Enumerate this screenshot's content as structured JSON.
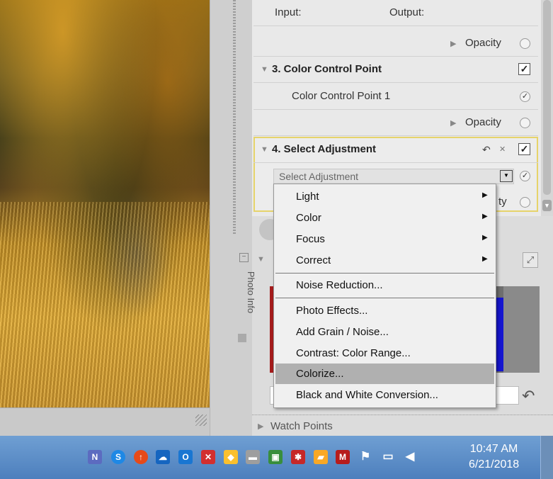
{
  "panel": {
    "input_label": "Input:",
    "output_label": "Output:",
    "opacity_label_1": "Opacity",
    "section3_title": "3. Color Control Point",
    "ccp1_label": "Color Control Point 1",
    "opacity_label_2": "Opacity",
    "section4_title": "4. Select Adjustment",
    "select_placeholder": "Select Adjustment",
    "opacity_partial": "ty",
    "check_mark": "✓",
    "undo_glyph": "↶",
    "close_glyph": "✕"
  },
  "menu": {
    "items": [
      {
        "label": "Light",
        "submenu": true
      },
      {
        "label": "Color",
        "submenu": true
      },
      {
        "label": "Focus",
        "submenu": true
      },
      {
        "label": "Correct",
        "submenu": true
      },
      {
        "label": "Noise Reduction..."
      },
      {
        "label": "Photo Effects..."
      },
      {
        "label": "Add Grain / Noise..."
      },
      {
        "label": "Contrast: Color Range..."
      },
      {
        "label": "Colorize...",
        "highlighted": true
      },
      {
        "label": "Black and White Conversion..."
      }
    ]
  },
  "lower": {
    "photo_info_label": "Photo Info",
    "watch_points_label": "Watch Points"
  },
  "taskbar": {
    "time": "10:47 AM",
    "date": "6/21/2018",
    "icons": [
      "nx-icon",
      "chat-icon",
      "upload-icon",
      "cloud-icon",
      "outlook-icon",
      "x-tool-icon",
      "shield-icon",
      "drive-icon",
      "display-icon",
      "network-icon",
      "folder-icon",
      "mcafee-icon",
      "flag-icon",
      "device-icon",
      "volume-icon"
    ]
  },
  "colors": {
    "highlight_border": "#e6d36a",
    "menu_highlight": "#b0b0b0",
    "taskbar_blue": "#5a8bc8"
  }
}
